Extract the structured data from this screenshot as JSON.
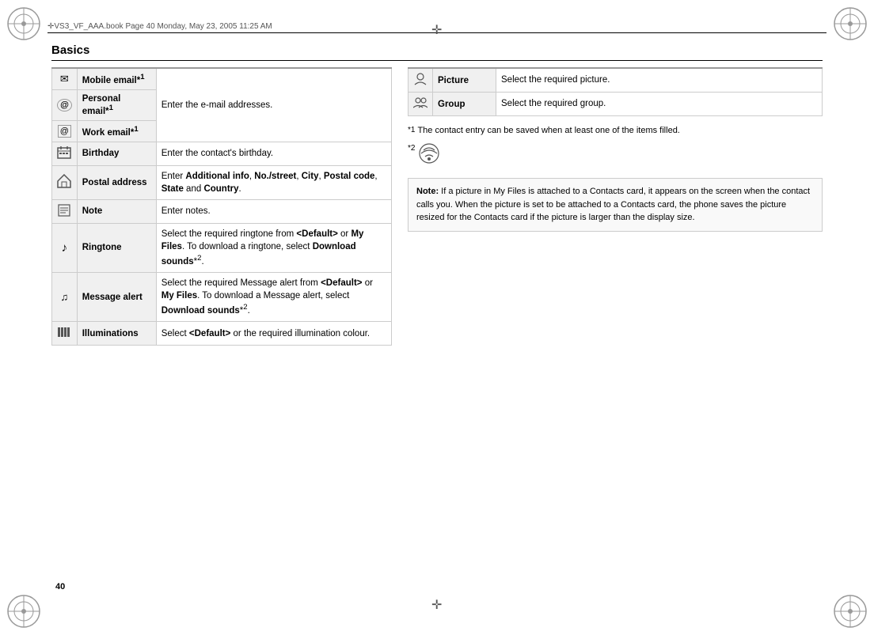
{
  "header": {
    "text": "VS3_VF_AAA.book   Page 40   Monday, May 23, 2005   11:25 AM"
  },
  "page_number": "40",
  "title": "Basics",
  "left_table": {
    "rows": [
      {
        "icon": "✉",
        "icon_name": "mobile-email-icon",
        "label": "Mobile email*1",
        "desc": "Enter the e-mail addresses.",
        "rowspan": 3
      },
      {
        "icon": "@",
        "icon_name": "personal-email-icon",
        "label": "Personal email*1",
        "desc": null
      },
      {
        "icon": "@",
        "icon_name": "work-email-icon",
        "label": "Work email*1",
        "desc": null
      },
      {
        "icon": "▦",
        "icon_name": "birthday-icon",
        "label": "Birthday",
        "desc": "Enter the contact's birthday."
      },
      {
        "icon": "⌂",
        "icon_name": "postal-address-icon",
        "label": "Postal address",
        "desc_parts": [
          {
            "text": "Enter ",
            "bold": false
          },
          {
            "text": "Additional info",
            "bold": true
          },
          {
            "text": ", ",
            "bold": false
          },
          {
            "text": "No./street",
            "bold": true
          },
          {
            "text": ", ",
            "bold": false
          },
          {
            "text": "City",
            "bold": true
          },
          {
            "text": ", ",
            "bold": false
          },
          {
            "text": "Postal code",
            "bold": true
          },
          {
            "text": ", ",
            "bold": false
          },
          {
            "text": "State",
            "bold": true
          },
          {
            "text": " and ",
            "bold": false
          },
          {
            "text": "Country",
            "bold": true
          },
          {
            "text": ".",
            "bold": false
          }
        ]
      },
      {
        "icon": "≡",
        "icon_name": "note-icon",
        "label": "Note",
        "desc": "Enter notes."
      },
      {
        "icon": "♪",
        "icon_name": "ringtone-icon",
        "label": "Ringtone",
        "desc_parts": [
          {
            "text": "Select the required ringtone from ",
            "bold": false
          },
          {
            "text": "<Default>",
            "bold": true
          },
          {
            "text": " or ",
            "bold": false
          },
          {
            "text": "My Files",
            "bold": true
          },
          {
            "text": ". To download a ringtone, select ",
            "bold": false
          },
          {
            "text": "Download sounds",
            "bold": true
          },
          {
            "text": "*2.",
            "bold": false
          }
        ]
      },
      {
        "icon": "♫",
        "icon_name": "message-alert-icon",
        "label": "Message alert",
        "desc_parts": [
          {
            "text": "Select the required Message alert from ",
            "bold": false
          },
          {
            "text": "<Default>",
            "bold": true
          },
          {
            "text": " or ",
            "bold": false
          },
          {
            "text": "My Files",
            "bold": true
          },
          {
            "text": ". To download a Message alert, select ",
            "bold": false
          },
          {
            "text": "Download sounds",
            "bold": true
          },
          {
            "text": "*2.",
            "bold": false
          }
        ]
      },
      {
        "icon": "|||",
        "icon_name": "illuminations-icon",
        "label": "Illuminations",
        "desc_parts": [
          {
            "text": "Select ",
            "bold": false
          },
          {
            "text": "<Default>",
            "bold": true
          },
          {
            "text": " or the required illumination colour.",
            "bold": false
          }
        ]
      }
    ]
  },
  "right_table": {
    "rows": [
      {
        "icon": "👤",
        "icon_name": "picture-icon",
        "label": "Picture",
        "desc": "Select the required picture."
      },
      {
        "icon": "👥",
        "icon_name": "group-icon",
        "label": "Group",
        "desc": "Select the required group."
      }
    ]
  },
  "footnotes": {
    "star1": "*1",
    "star1_text": "The contact entry can be saved when at least one of the items filled.",
    "star2": "*2"
  },
  "note_box": {
    "label": "Note:",
    "text": " If a picture in My Files is attached to a Contacts card, it appears on the screen when the contact calls you. When the picture is set to be attached to a Contacts card, the phone saves the picture resized for the Contacts card if the picture is larger than the display size."
  }
}
